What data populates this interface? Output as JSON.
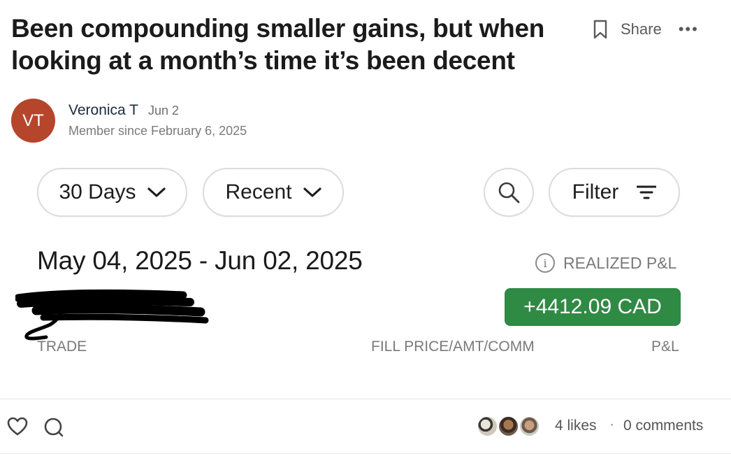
{
  "post": {
    "title": "Been compounding smaller gains, but when looking at a month’s time it’s been decent",
    "share_label": "Share",
    "more_label": "•••"
  },
  "author": {
    "initials": "VT",
    "name": "Veronica T",
    "date": "Jun 2",
    "member_since": "Member since February 6, 2025",
    "avatar_color": "#b5452b"
  },
  "filters": {
    "period_label": "30 Days",
    "sort_label": "Recent",
    "filter_label": "Filter"
  },
  "summary": {
    "date_range": "May 04, 2025 - Jun 02, 2025",
    "info_glyph": "i",
    "realized_label": "REALIZED P&L",
    "pnl_value": "+4412.09 CAD",
    "pnl_color": "#2f8a44"
  },
  "columns": {
    "trade": "TRADE",
    "fill": "FILL PRICE/AMT/COMM",
    "pnl": "P&L"
  },
  "footer": {
    "likes": "4 likes",
    "separator": "·",
    "comments": "0 comments"
  },
  "icons": [
    "bookmark-icon",
    "more-icon",
    "chevron-down-icon",
    "search-icon",
    "filter-icon",
    "info-icon",
    "heart-icon",
    "comment-icon"
  ]
}
